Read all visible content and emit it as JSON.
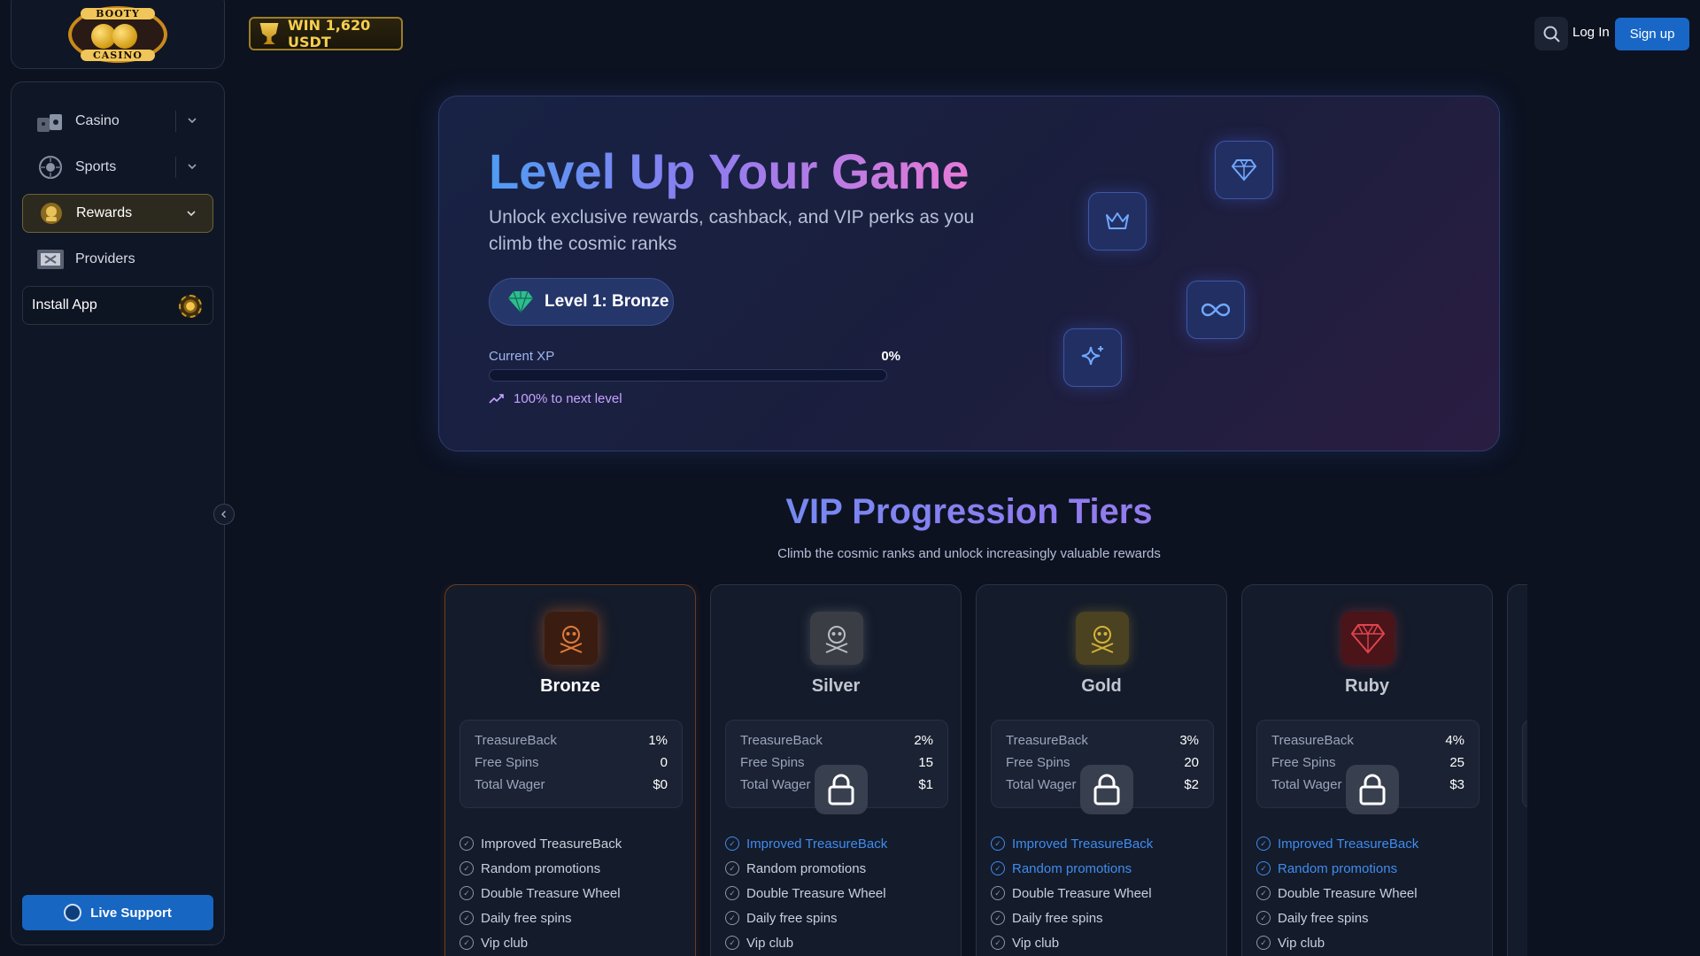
{
  "brand": {
    "logo_top_text": "BOOTY",
    "logo_bottom_text": "CASINO"
  },
  "header": {
    "promo_text": "WIN 1,620 USDT",
    "login_label": "Log In",
    "signup_label": "Sign up"
  },
  "sidebar": {
    "items": [
      {
        "label": "Casino",
        "icon": "casino-icon"
      },
      {
        "label": "Sports",
        "icon": "sports-icon"
      },
      {
        "label": "Rewards",
        "icon": "rewards-icon"
      },
      {
        "label": "Providers",
        "icon": "providers-icon"
      }
    ],
    "install_label": "Install App",
    "support_label": "Live Support"
  },
  "hero": {
    "title": "Level Up Your Game",
    "subtitle": "Unlock exclusive rewards, cashback, and VIP perks as you climb the cosmic ranks",
    "level_label": "Level 1: Bronze",
    "xp_label": "Current XP",
    "xp_value": "0%",
    "xp_progress": 0,
    "next_level_text": "100% to next level"
  },
  "vip": {
    "title": "VIP Progression Tiers",
    "subtitle": "Climb the cosmic ranks and unlock increasingly valuable rewards",
    "stat_labels": [
      "TreasureBack",
      "Free Spins",
      "Total Wager"
    ],
    "tiers": [
      {
        "name": "Bronze",
        "locked": false,
        "color": "#e07b3a",
        "stats": [
          "1%",
          "0",
          "$0"
        ],
        "perks": [
          {
            "label": "Improved TreasureBack",
            "highlight": false
          },
          {
            "label": "Random promotions",
            "highlight": false
          },
          {
            "label": "Double Treasure Wheel",
            "highlight": false
          },
          {
            "label": "Daily free spins",
            "highlight": false
          },
          {
            "label": "Vip club",
            "highlight": false
          }
        ]
      },
      {
        "name": "Silver",
        "locked": true,
        "color": "#b8bcc6",
        "stats": [
          "2%",
          "15",
          "$1"
        ],
        "perks": [
          {
            "label": "Improved TreasureBack",
            "highlight": true
          },
          {
            "label": "Random promotions",
            "highlight": false
          },
          {
            "label": "Double Treasure Wheel",
            "highlight": false
          },
          {
            "label": "Daily free spins",
            "highlight": false
          },
          {
            "label": "Vip club",
            "highlight": false
          }
        ]
      },
      {
        "name": "Gold",
        "locked": true,
        "color": "#d4b13b",
        "stats": [
          "3%",
          "20",
          "$2"
        ],
        "perks": [
          {
            "label": "Improved TreasureBack",
            "highlight": true
          },
          {
            "label": "Random promotions",
            "highlight": true
          },
          {
            "label": "Double Treasure Wheel",
            "highlight": false
          },
          {
            "label": "Daily free spins",
            "highlight": false
          },
          {
            "label": "Vip club",
            "highlight": false
          }
        ]
      },
      {
        "name": "Ruby",
        "locked": true,
        "color": "#e0444f",
        "stats": [
          "4%",
          "25",
          "$3"
        ],
        "perks": [
          {
            "label": "Improved TreasureBack",
            "highlight": true
          },
          {
            "label": "Random promotions",
            "highlight": true
          },
          {
            "label": "Double Treasure Wheel",
            "highlight": false
          },
          {
            "label": "Daily free spins",
            "highlight": false
          },
          {
            "label": "Vip club",
            "highlight": false
          }
        ]
      }
    ]
  },
  "colors": {
    "accent_blue": "#1867c7",
    "gradient_start": "#4f9cf3",
    "gradient_end": "#e77ad6",
    "highlight_perk": "#3f8cf0"
  }
}
